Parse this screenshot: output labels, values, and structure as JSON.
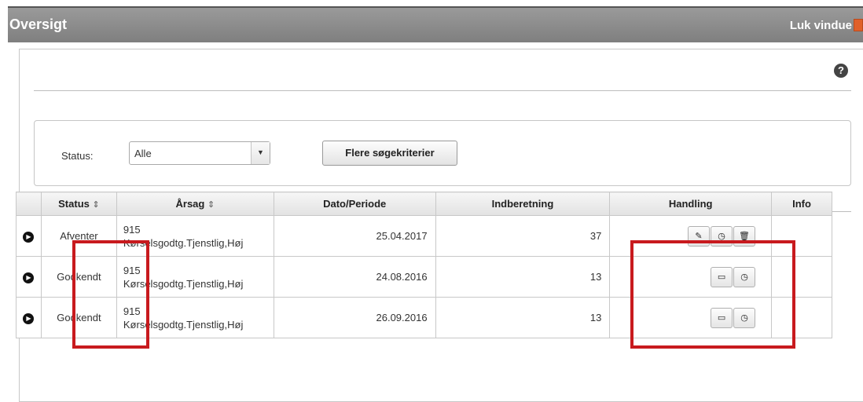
{
  "window": {
    "title": "Oversigt",
    "close_label": "Luk vindue"
  },
  "help_icon": "?",
  "filter": {
    "status_label": "Status:",
    "status_value": "Alle",
    "more_button": "Flere søgekriterier"
  },
  "table": {
    "columns": [
      "",
      "Status",
      "Årsag",
      "Dato/Periode",
      "Indberetning",
      "Handling",
      "Info"
    ],
    "sort_glyph": "⇕",
    "rows": [
      {
        "status": "Afventer",
        "arsag_code": "915",
        "arsag_text": "Kørselsgodtg.Tjenstlig,Høj",
        "dato": "25.04.2017",
        "indberetning": "37",
        "actions": [
          "edit-icon",
          "clock-icon",
          "trash-icon"
        ]
      },
      {
        "status": "Godkendt",
        "arsag_code": "915",
        "arsag_text": "Kørselsgodtg.Tjenstlig,Høj",
        "dato": "24.08.2016",
        "indberetning": "13",
        "actions": [
          "comment-icon",
          "clock-icon"
        ]
      },
      {
        "status": "Godkendt",
        "arsag_code": "915",
        "arsag_text": "Kørselsgodtg.Tjenstlig,Høj",
        "dato": "26.09.2016",
        "indberetning": "13",
        "actions": [
          "comment-icon",
          "clock-icon"
        ]
      }
    ]
  },
  "highlight_color": "#c81a1e"
}
